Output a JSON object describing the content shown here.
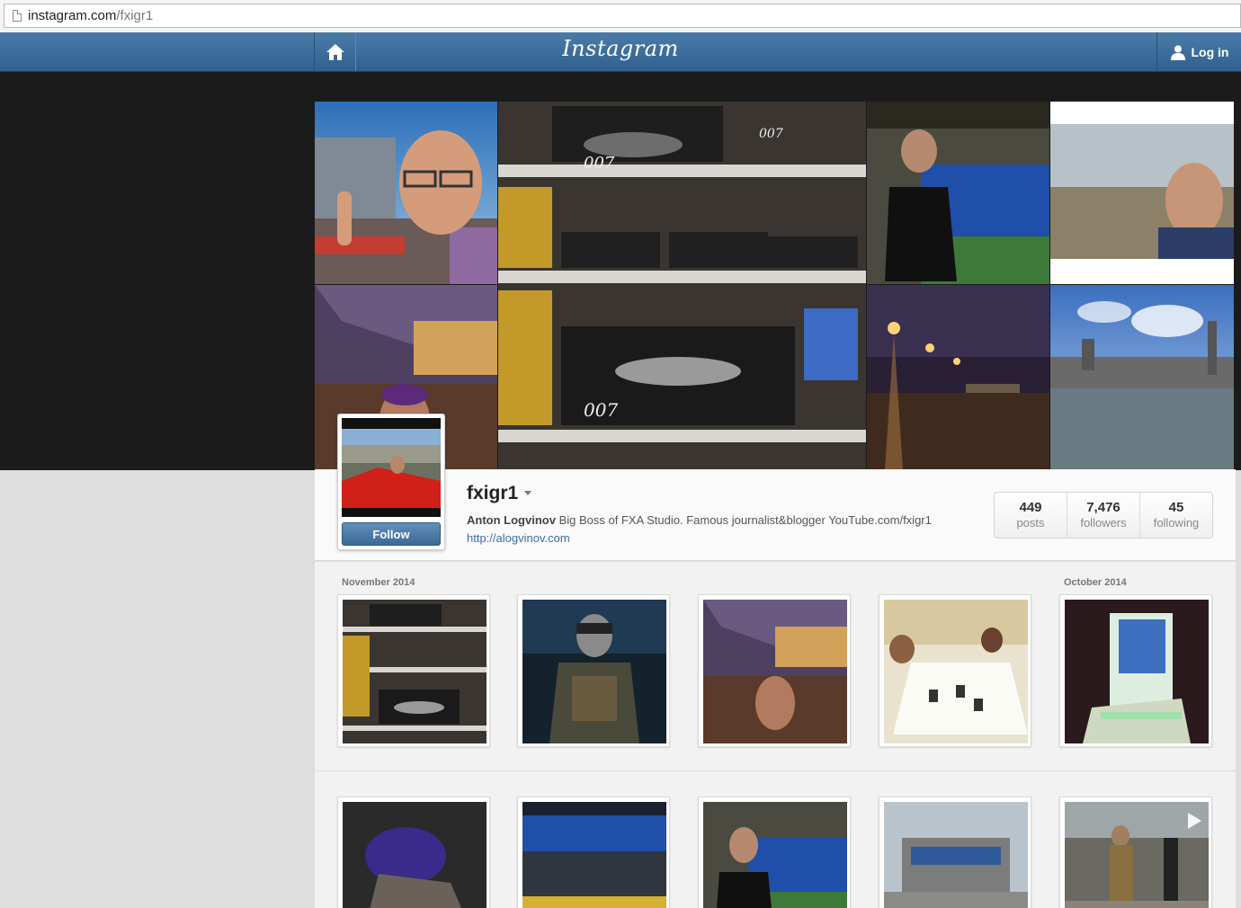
{
  "browser": {
    "url_host": "instagram.com",
    "url_path": "/fxigr1"
  },
  "nav": {
    "logo": "Instagram",
    "login_label": "Log in"
  },
  "profile": {
    "username": "fxigr1",
    "full_name": "Anton Logvinov",
    "bio": "Big Boss of FXA Studio. Famous journalist&blogger YouTube.com/fxigr1",
    "website": "http://alogvinov.com",
    "follow_label": "Follow",
    "stats": [
      {
        "value": "449",
        "label": "posts"
      },
      {
        "value": "7,476",
        "label": "followers"
      },
      {
        "value": "45",
        "label": "following"
      }
    ]
  },
  "feed": {
    "months": [
      "November 2014",
      "October 2014"
    ]
  },
  "colors": {
    "nav_blue": "#3a6a98",
    "link_blue": "#3b6fa4",
    "hero_bg": "#1b1b1b"
  }
}
